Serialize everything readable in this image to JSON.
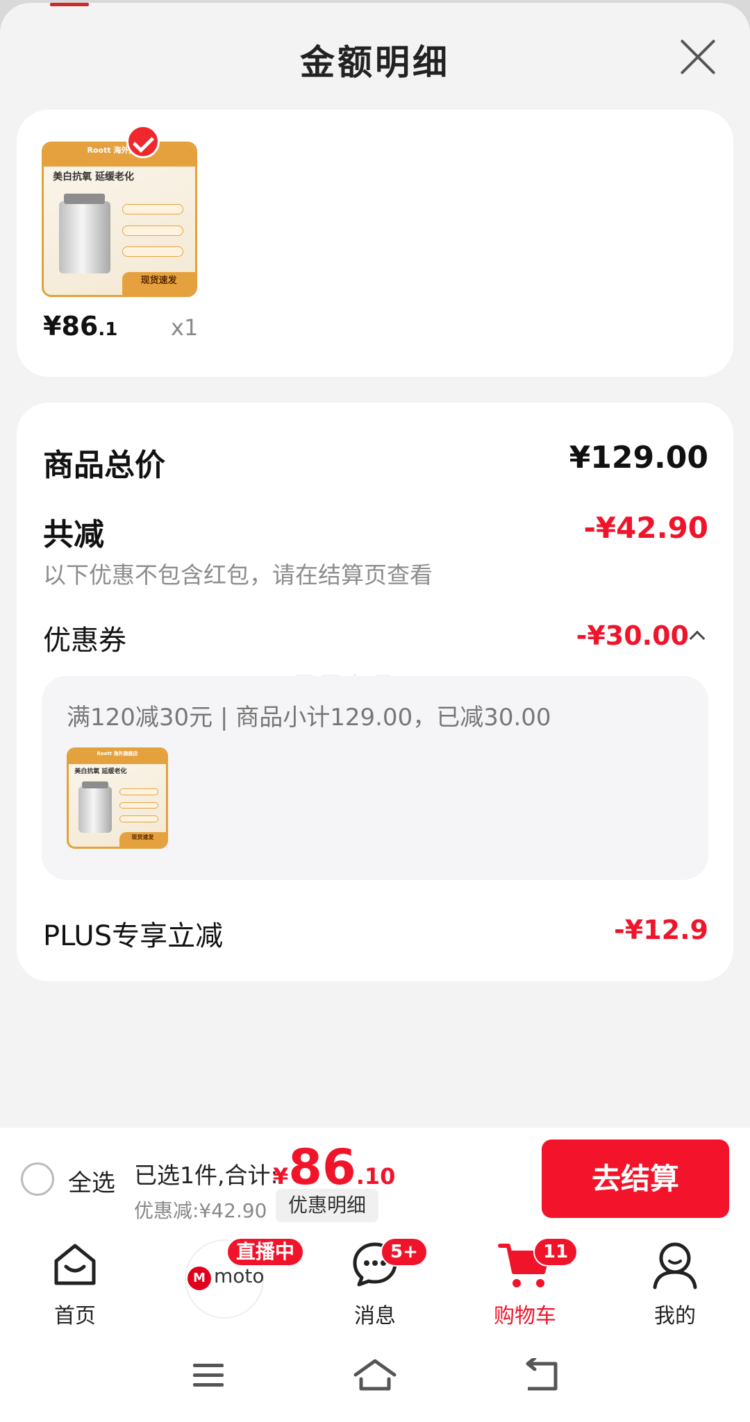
{
  "sheet": {
    "title": "金额明细"
  },
  "item": {
    "thumb": {
      "brand": "Roott 海外旗舰店",
      "headline": "美白抗氧 延缓老化",
      "ribbon": "现货速发"
    },
    "price_symbol_int": "¥86",
    "price_decimal": ".1",
    "quantity": "x1"
  },
  "detail": {
    "total_label": "商品总价",
    "total_value": "¥129.00",
    "reduce_label": "共减",
    "reduce_value": "-¥42.90",
    "note": "以下优惠不包含红包，请在结算页查看",
    "coupon_label": "优惠券",
    "coupon_value": "-¥30.00",
    "watermark": "果果有品",
    "coupon_desc": "满120减30元 | 商品小计129.00，已减30.00",
    "plus_label": "PLUS专享立减",
    "plus_value": "-¥12.9"
  },
  "checkout": {
    "select_all": "全选",
    "selected_info": "已选1件,合计:",
    "currency": "¥",
    "total_int": "86",
    "total_dec": ".10",
    "discount_info": "优惠减:¥42.90",
    "detail_link": "优惠明细",
    "button": "去结算"
  },
  "tabbar": {
    "home": "首页",
    "live_badge": "直播中",
    "live_brand": "moto",
    "messages": "消息",
    "messages_badge": "5+",
    "cart": "购物车",
    "cart_badge": "11",
    "mine": "我的"
  },
  "colors": {
    "accent": "#f0142b",
    "sheet_bg": "#f3f3f3"
  }
}
